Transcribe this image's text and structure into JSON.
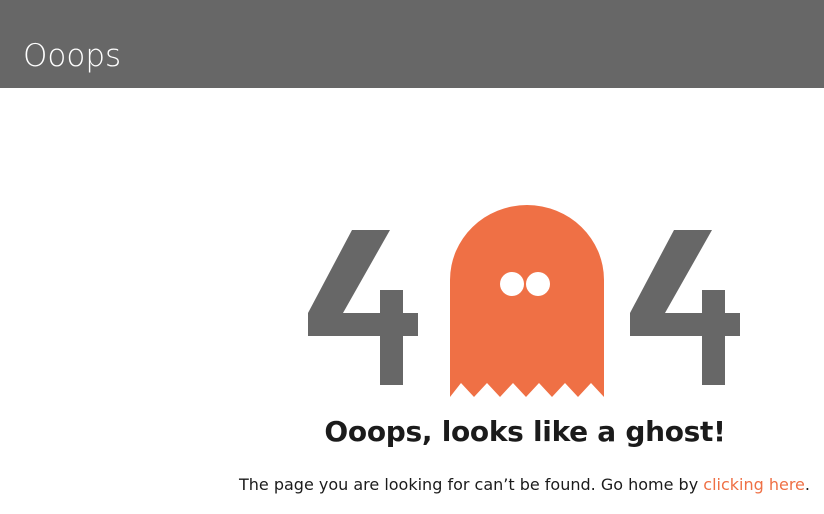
{
  "header": {
    "title": "Ooops"
  },
  "error": {
    "digit_left": "4",
    "digit_right": "4",
    "headline": "Ooops, looks like a ghost!",
    "message_prefix": "The page you are looking for can’t be found. Go home by ",
    "link_text": "clicking here",
    "message_suffix": "."
  },
  "colors": {
    "header_bg": "#676767",
    "digit": "#676767",
    "ghost": "#ef7045",
    "link": "#ef7045",
    "text": "#1b1b1b"
  },
  "icons": {
    "ghost": "ghost-icon"
  }
}
